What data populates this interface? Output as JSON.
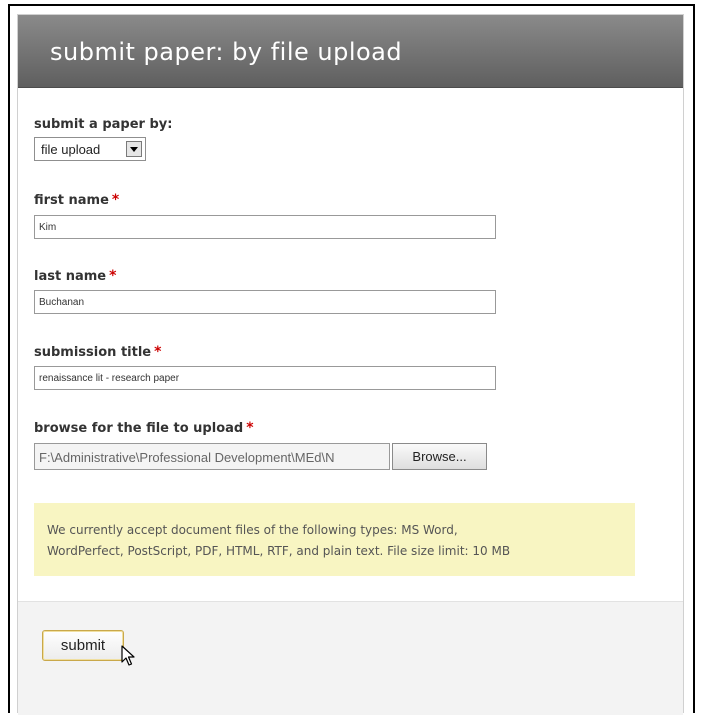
{
  "header": {
    "title": "submit paper: by file upload"
  },
  "submit_by": {
    "label": "submit a paper by:",
    "selected": "file upload"
  },
  "required_marker": "*",
  "first_name": {
    "label": "first name",
    "value": "Kim"
  },
  "last_name": {
    "label": "last name",
    "value": "Buchanan"
  },
  "submission_title": {
    "label": "submission title",
    "value": "renaissance lit - research paper"
  },
  "file": {
    "label": "browse for the file to upload",
    "path": "F:\\Administrative\\Professional Development\\MEd\\N",
    "browse_label": "Browse..."
  },
  "note": {
    "line1": "We currently accept document files of the following types: MS Word,",
    "line2": "WordPerfect, PostScript, PDF, HTML, RTF, and plain text. File size limit: 10 MB",
    "background": "#f8f5c2"
  },
  "actions": {
    "submit_label": "submit"
  },
  "colors": {
    "header": "#6f6f6f",
    "required": "#cc0000",
    "button_border": "#c9a84a"
  }
}
